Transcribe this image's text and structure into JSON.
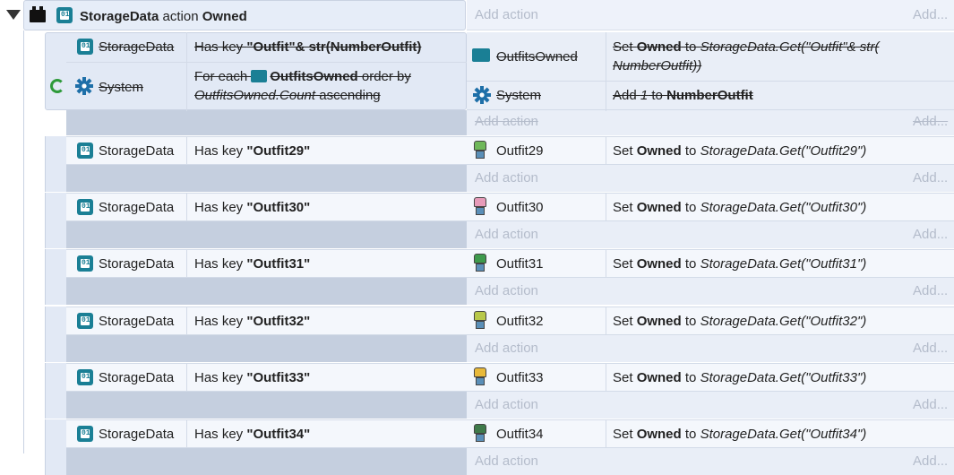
{
  "header": {
    "object": "StorageData",
    "keyword": "action",
    "name": "Owned",
    "add_action": "Add action",
    "add_more": "Add..."
  },
  "group": {
    "cond1": {
      "object": "StorageData",
      "text_pre": "Has key ",
      "text_bold": "\"Outfit\"& str(NumberOutfit)"
    },
    "cond2": {
      "object": "System",
      "text_pre": "For each ",
      "text_obj": "OutfitsOwned",
      "text_post": " order by",
      "text_line2_italic": "OutfitsOwned.Count",
      "text_line2_post": " ascending"
    },
    "act1": {
      "object": "OutfitsOwned",
      "text_pre": "Set ",
      "text_bold": "Owned",
      "text_mid": " to ",
      "text_italic": "StorageData.Get(\"Outfit\"& str(",
      "text_italic2": "NumberOutfit))"
    },
    "act2": {
      "object": "System",
      "text_pre": "Add ",
      "text_italic": "1",
      "text_mid": " to ",
      "text_bold": "NumberOutfit"
    },
    "add_action": "Add action",
    "add_more": "Add..."
  },
  "events": [
    {
      "cond_object": "StorageData",
      "cond_pre": "Has key ",
      "cond_key": "\"Outfit29\"",
      "act_object": "Outfit29",
      "act_pre": "Set ",
      "act_var": "Owned",
      "act_mid": " to ",
      "act_expr": "StorageData.Get(\"Outfit29\")",
      "add_action": "Add action",
      "add_more": "Add..."
    },
    {
      "cond_object": "StorageData",
      "cond_pre": "Has key ",
      "cond_key": "\"Outfit30\"",
      "act_object": "Outfit30",
      "act_pre": "Set ",
      "act_var": "Owned",
      "act_mid": " to ",
      "act_expr": "StorageData.Get(\"Outfit30\")",
      "add_action": "Add action",
      "add_more": "Add..."
    },
    {
      "cond_object": "StorageData",
      "cond_pre": "Has key ",
      "cond_key": "\"Outfit31\"",
      "act_object": "Outfit31",
      "act_pre": "Set ",
      "act_var": "Owned",
      "act_mid": " to ",
      "act_expr": "StorageData.Get(\"Outfit31\")",
      "add_action": "Add action",
      "add_more": "Add..."
    },
    {
      "cond_object": "StorageData",
      "cond_pre": "Has key ",
      "cond_key": "\"Outfit32\"",
      "act_object": "Outfit32",
      "act_pre": "Set ",
      "act_var": "Owned",
      "act_mid": " to ",
      "act_expr": "StorageData.Get(\"Outfit32\")",
      "add_action": "Add action",
      "add_more": "Add..."
    },
    {
      "cond_object": "StorageData",
      "cond_pre": "Has key ",
      "cond_key": "\"Outfit33\"",
      "act_object": "Outfit33",
      "act_pre": "Set ",
      "act_var": "Owned",
      "act_mid": " to ",
      "act_expr": "StorageData.Get(\"Outfit33\")",
      "add_action": "Add action",
      "add_more": "Add..."
    },
    {
      "cond_object": "StorageData",
      "cond_pre": "Has key ",
      "cond_key": "\"Outfit34\"",
      "act_object": "Outfit34",
      "act_pre": "Set ",
      "act_var": "Owned",
      "act_mid": " to ",
      "act_expr": "StorageData.Get(\"Outfit34\")",
      "add_action": "Add action",
      "add_more": "Add..."
    }
  ],
  "colors": {
    "storage_icon": "#1a7f95",
    "gear": "#1e6fa8",
    "loop_arrow": "#2e9a3a",
    "band": "#c5cfdf"
  }
}
